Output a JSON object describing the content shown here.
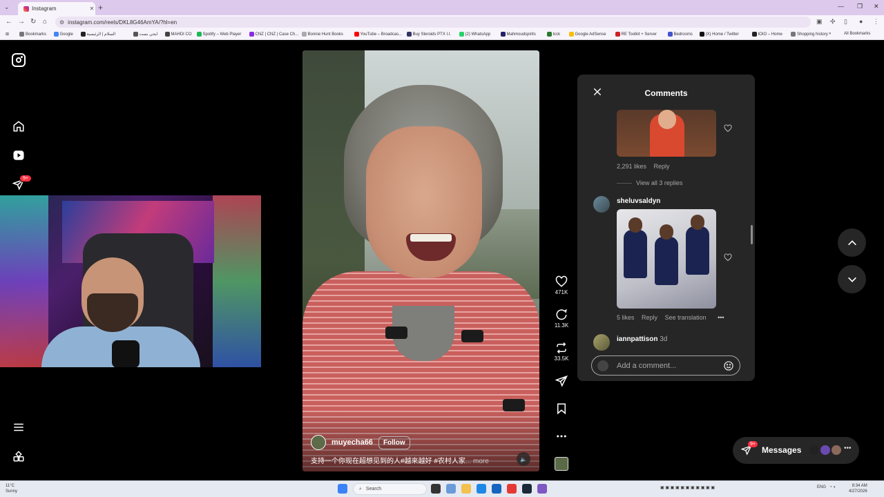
{
  "browser": {
    "tab_title": "Instagram",
    "url": "instagram.com/reels/DKL8G46AmYA/?hl=en",
    "new_tab": "+",
    "bookmarks": [
      {
        "label": "Bookmarks",
        "color": "#777777"
      },
      {
        "label": "Google",
        "color": "#4285f4"
      },
      {
        "label": "السلام | الرئيسية",
        "color": "#222222"
      },
      {
        "label": "ايجي بست",
        "color": "#555555"
      },
      {
        "label": "MAHDI CO",
        "color": "#444444"
      },
      {
        "label": "Spotify – Web Player",
        "color": "#1db954"
      },
      {
        "label": "CNZ | CNZ | Case Ch...",
        "color": "#8a2be2"
      },
      {
        "label": "Bonnie Hunt Books",
        "color": "#aaaaaa"
      },
      {
        "label": "YouTube – Broadcas...",
        "color": "#ff0000"
      },
      {
        "label": "Buy Steroids PTX I.I.",
        "color": "#333366"
      },
      {
        "label": "(2) WhatsApp",
        "color": "#25d366"
      },
      {
        "label": "Mahmoudspirits",
        "color": "#222266"
      },
      {
        "label": "Icck",
        "color": "#2a7a2a"
      },
      {
        "label": "Google AdSense",
        "color": "#fbbc05"
      },
      {
        "label": "RE Toolkit + Server",
        "color": "#cc2222"
      },
      {
        "label": "Bedrooms",
        "color": "#4455cc"
      },
      {
        "label": "(X) Home / Twitter",
        "color": "#111111"
      },
      {
        "label": "IOIO – Home",
        "color": "#222222"
      },
      {
        "label": "Shopping history",
        "color": "#777777"
      }
    ],
    "all_bookmarks": "All Bookmarks"
  },
  "sidebar": {
    "notifications_badge": "9+"
  },
  "reel": {
    "username": "muyecha66",
    "follow_label": "Follow",
    "caption": "支持一个你现在超想见到的人#越來越好 #农村人家",
    "caption_more": "... more",
    "likes": "471K",
    "comments": "11.3K",
    "reposts": "33.5K"
  },
  "comments_panel": {
    "title": "Comments",
    "first_likes": "2,291 likes",
    "reply_label": "Reply",
    "view_replies": "View all 3 replies",
    "second_user": "sheluvsaldyn",
    "second_likes": "5 likes",
    "second_reply": "Reply",
    "see_translation": "See translation",
    "third_user": "iannpattison",
    "third_ago": "3d",
    "add_comment_placeholder": "Add a comment..."
  },
  "messages": {
    "label": "Messages",
    "badge": "9+"
  },
  "taskbar": {
    "temp": "11°C",
    "condition": "Sunny",
    "search": "Search",
    "lang": "ENG",
    "time": "8:34 AM",
    "date": "4/27/2026"
  },
  "colors": {
    "accent_badge": "#ff3040",
    "panel": "#262626",
    "page_bg": "#000000"
  }
}
